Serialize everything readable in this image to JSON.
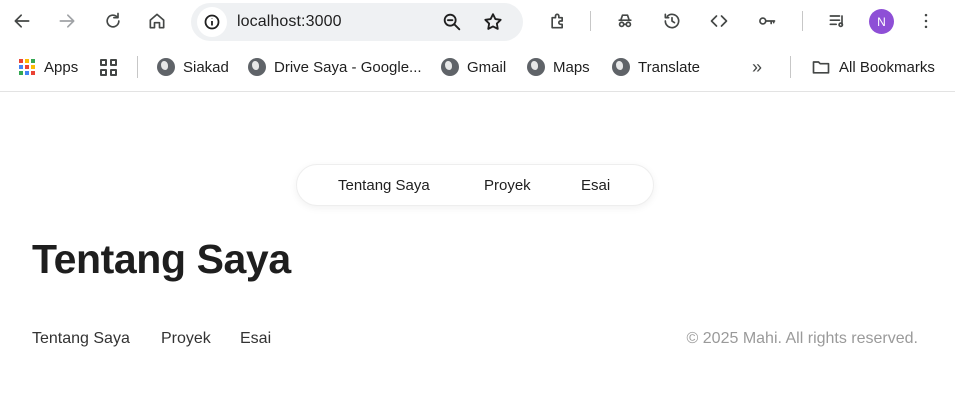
{
  "browser": {
    "url": "localhost:3000",
    "avatar_initial": "N",
    "avatar_color": "#8e4fd6",
    "toolbar_icons": [
      "back-icon",
      "forward-icon",
      "reload-icon",
      "home-icon",
      "site-info-icon",
      "zoom-icon",
      "bookmark-star-icon",
      "extensions-icon",
      "incognito-icon",
      "history-icon",
      "devtools-icon",
      "password-key-icon",
      "media-queue-icon",
      "menu-kebab-icon"
    ]
  },
  "bookmarks": {
    "apps_label": "Apps",
    "items": [
      {
        "label": "Siakad"
      },
      {
        "label": "Drive Saya - Google..."
      },
      {
        "label": "Gmail"
      },
      {
        "label": "Maps"
      },
      {
        "label": "Translate"
      }
    ],
    "more_icon": "chevron-double-right-icon",
    "all_bookmarks_label": "All Bookmarks"
  },
  "site": {
    "nav": [
      "Tentang Saya",
      "Proyek",
      "Esai"
    ],
    "page_title": "Tentang Saya",
    "footer_nav": [
      "Tentang Saya",
      "Proyek",
      "Esai"
    ],
    "copyright": "© 2025 Mahi. All rights reserved."
  }
}
